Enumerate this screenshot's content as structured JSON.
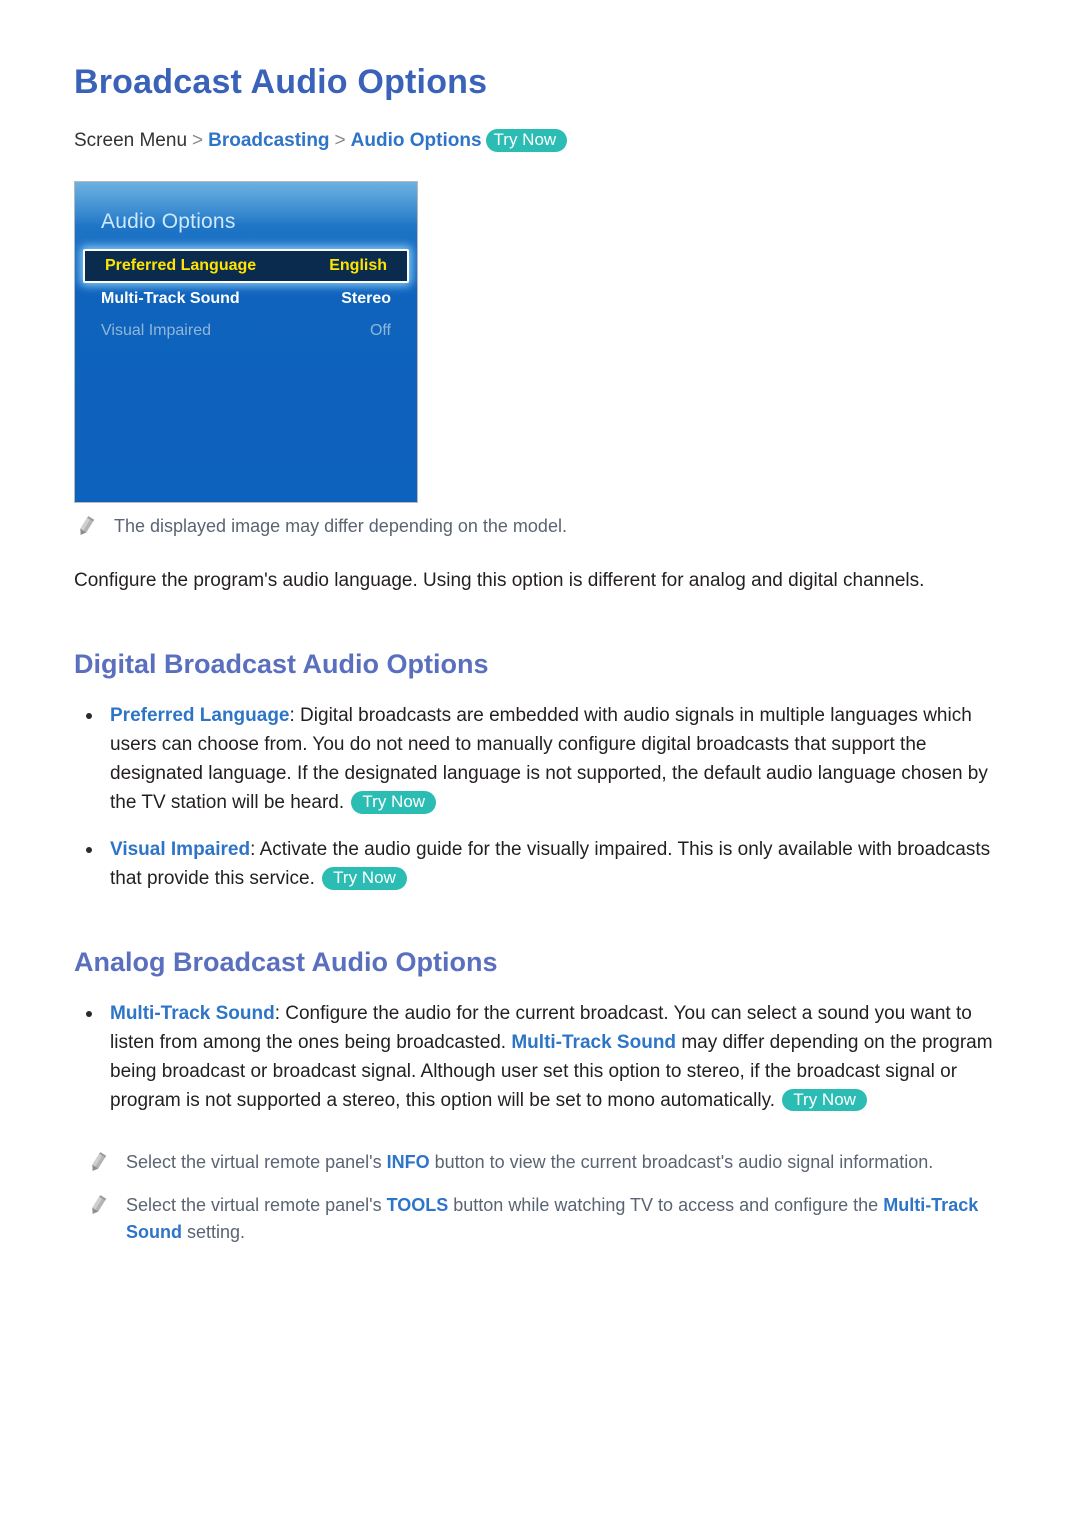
{
  "document": {
    "title": "Broadcast Audio Options",
    "breadcrumb": {
      "root": "Screen Menu",
      "separator": ">",
      "level2": "Broadcasting",
      "level3": "Audio Options",
      "try_now": "Try Now"
    },
    "intro_paragraph": "Configure the program's audio language. Using this option is different for analog and digital channels.",
    "image_note": {
      "icon": "pencil-icon",
      "text": "The displayed image may differ depending on the model."
    }
  },
  "tv_menu": {
    "title": "Audio Options",
    "rows": [
      {
        "label": "Preferred Language",
        "value": "English",
        "state": "selected"
      },
      {
        "label": "Multi-Track Sound",
        "value": "Stereo",
        "state": "normal"
      },
      {
        "label": "Visual Impaired",
        "value": "Off",
        "state": "dimmed"
      }
    ]
  },
  "sections": [
    {
      "heading": "Digital Broadcast Audio Options",
      "bullets": [
        {
          "term": "Preferred Language",
          "colon": ":",
          "text": " Digital broadcasts are embedded with audio signals in multiple languages which users can choose from. You do not need to manually configure digital broadcasts that support the designated language. If the designated language is not supported, the default audio language chosen by the TV station will be heard. ",
          "try_now": "Try Now"
        },
        {
          "term": "Visual Impaired",
          "colon": ":",
          "text": " Activate the audio guide for the visually impaired. This is only available with broadcasts that provide this service. ",
          "try_now": "Try Now"
        }
      ]
    },
    {
      "heading": "Analog Broadcast Audio Options",
      "bullets": [
        {
          "term": "Multi-Track Sound",
          "colon": ":",
          "text_part1": " Configure the audio for the current broadcast. You can select a sound you want to listen from among the ones being broadcasted. ",
          "inline_term": "Multi-Track Sound",
          "text_part2": " may differ depending on the program being broadcast or broadcast signal. Although user set this option to stereo, if the broadcast signal or program is not supported a stereo, this option will be set to mono automatically. ",
          "try_now": "Try Now"
        }
      ]
    }
  ],
  "footer_notes": [
    {
      "icon": "pencil-icon",
      "part1": "Select the virtual remote panel's ",
      "highlight1": "INFO",
      "part2": " button to view the current broadcast's audio signal information."
    },
    {
      "icon": "pencil-icon",
      "part1": "Select the virtual remote panel's ",
      "highlight1": "TOOLS",
      "part2": " button while watching TV to access and configure the ",
      "highlight2": "Multi-Track Sound",
      "part3": " setting."
    }
  ],
  "colors": {
    "title_blue": "#3a62b8",
    "link_blue": "#2e75c8",
    "heading_blue": "#5b6fbf",
    "try_now_teal": "#2bbdb4",
    "tv_panel_blue": "#0d62bd",
    "tv_selected_navy": "#0a2a4e",
    "tv_selected_yellow": "#ffe400",
    "note_gray": "#5a6472"
  }
}
